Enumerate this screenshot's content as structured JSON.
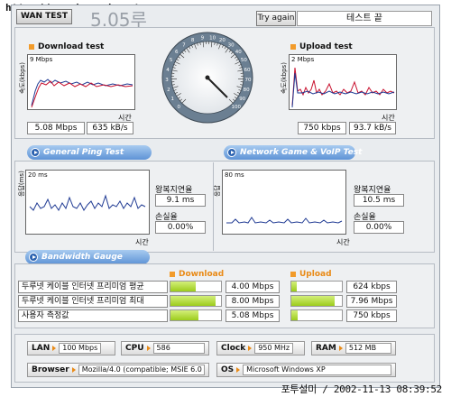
{
  "watermark_top": "http://www.bcpark.net",
  "watermark_bottom": "포투설미 / 2002-11-13 08:39:52",
  "header": {
    "wan_tab": "WAN TEST",
    "speed_display": "5.05루",
    "try_again": "Try again",
    "status": "테스트 끝"
  },
  "download": {
    "title": "Download test",
    "y_axis": "속도(kbps)",
    "scale": "9 Mbps",
    "x_axis": "시간",
    "value1": "5.08 Mbps",
    "value2": "635 kB/s"
  },
  "upload": {
    "title": "Upload test",
    "y_axis": "속도(kbps)",
    "scale": "2 Mbps",
    "x_axis": "시간",
    "value1": "750 kbps",
    "value2": "93.7 kB/s"
  },
  "gauge": {
    "ticks": [
      "0",
      "1",
      "2",
      "3",
      "4",
      "5",
      "6",
      "7",
      "8",
      "9",
      "10",
      "20",
      "30",
      "40",
      "50",
      "60",
      "70",
      "80",
      "90",
      "100"
    ]
  },
  "banners": {
    "ping": "General Ping Test",
    "game": "Network Game & VoIP Test",
    "bandwidth": "Bandwidth Gauge"
  },
  "ping": {
    "y_axis": "응답(ms)",
    "scale": "20 ms",
    "x_axis": "시간",
    "rtt_label": "왕복지연율",
    "rtt_value": "9.1 ms",
    "loss_label": "손실율",
    "loss_value": "0.00%"
  },
  "game": {
    "y_axis": "응답",
    "scale": "80 ms",
    "x_axis": "시간",
    "rtt_label": "왕복지연율",
    "rtt_value": "10.5 ms",
    "loss_label": "손실율",
    "loss_value": "0.00%"
  },
  "bandwidth": {
    "download_header": "Download",
    "upload_header": "Upload",
    "rows": [
      {
        "name": "두루넷 케이블 인터넷 프리미엄 평균",
        "down": "4.00 Mbps",
        "up": "624 kbps",
        "down_frac": 0.5,
        "up_frac": 0.1
      },
      {
        "name": "두루넷 케이블 인터넷 프리미엄 최대",
        "down": "8.00 Mbps",
        "up": "7.96 Mbps",
        "down_frac": 0.9,
        "up_frac": 0.85
      },
      {
        "name": "사용자 측정값",
        "down": "5.08 Mbps",
        "up": "750 kbps",
        "down_frac": 0.55,
        "up_frac": 0.12
      }
    ]
  },
  "system": {
    "lan_label": "LAN",
    "lan_value": "100 Mbps",
    "cpu_label": "CPU",
    "cpu_value": "586",
    "clock_label": "Clock",
    "clock_value": "950 MHz",
    "ram_label": "RAM",
    "ram_value": "512 MB",
    "browser_label": "Browser",
    "browser_value": "Mozilla/4.0 (compatible; MSIE 6.0",
    "os_label": "OS",
    "os_value": "Microsoft Windows XP"
  },
  "colors": {
    "accent": "#f29b2a",
    "banner": "#5e93d6",
    "bar_fill": "#9ccc1c",
    "graph_red": "#c8102e",
    "graph_blue": "#1f3a93"
  }
}
